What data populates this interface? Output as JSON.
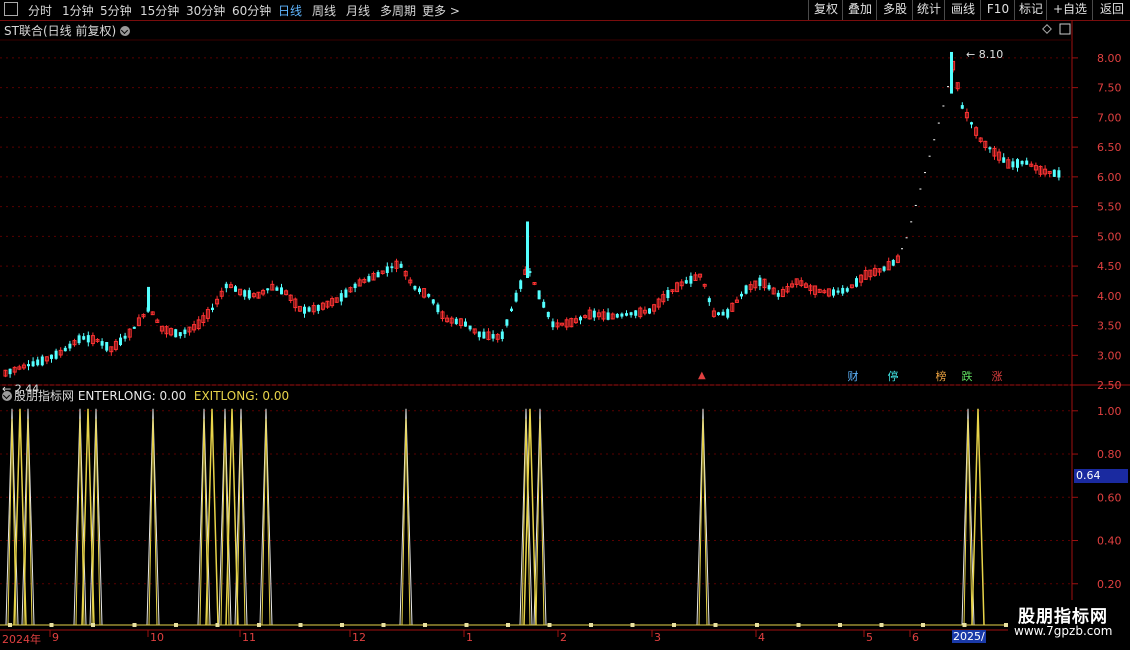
{
  "toolbar": {
    "left_items": [
      "分时",
      "1分钟",
      "5分钟",
      "15分钟",
      "30分钟",
      "60分钟",
      "日线",
      "周线",
      "月线",
      "多周期",
      "更多 >"
    ],
    "active": "日线",
    "right_items": [
      "复权",
      "叠加",
      "多股",
      "统计",
      "画线",
      "F10",
      "标记",
      "+自选",
      "返回"
    ]
  },
  "main_chart": {
    "title": "ST联合(日线 前复权)",
    "high_label": "8.10",
    "low_label": "2.44",
    "y_ticks": [
      "8.00",
      "7.50",
      "7.00",
      "6.50",
      "6.00",
      "5.50",
      "5.00",
      "4.50",
      "4.00",
      "3.50",
      "3.00",
      "2.50"
    ]
  },
  "events": [
    {
      "text": "财",
      "color": "#5fb6ff"
    },
    {
      "text": "停",
      "color": "#40e0e0"
    },
    {
      "text": "榜",
      "color": "#e8a040"
    },
    {
      "text": "跌",
      "color": "#60e060"
    },
    {
      "text": "涨",
      "color": "#e04040"
    }
  ],
  "indicator": {
    "name": "股朋指标网",
    "enter_label": "ENTERLONG:",
    "enter_value": "0.00",
    "exit_label": "EXITLONG:",
    "exit_value": "0.00",
    "y_ticks": [
      "1.00",
      "0.80",
      "0.60",
      "0.40",
      "0.20"
    ],
    "current_value": "0.64"
  },
  "date_axis": {
    "year_start": "2024年",
    "months": [
      "9",
      "10",
      "11",
      "12",
      "1",
      "2",
      "3",
      "4",
      "5",
      "6"
    ],
    "year_end": "2025/"
  },
  "watermark": {
    "line1": "股朋指标网",
    "line2": "www.7gpzb.com"
  },
  "chart_data": {
    "type": "candlestick",
    "y_range": [
      2.4,
      8.2
    ],
    "indicator_range": [
      0,
      1.05
    ],
    "enter_peaks_x": [
      12,
      28,
      80,
      96,
      153,
      204,
      225,
      241,
      266,
      406,
      526,
      540,
      703,
      968
    ],
    "exit_peaks_x": [
      20,
      88,
      212,
      232,
      530,
      978
    ]
  }
}
